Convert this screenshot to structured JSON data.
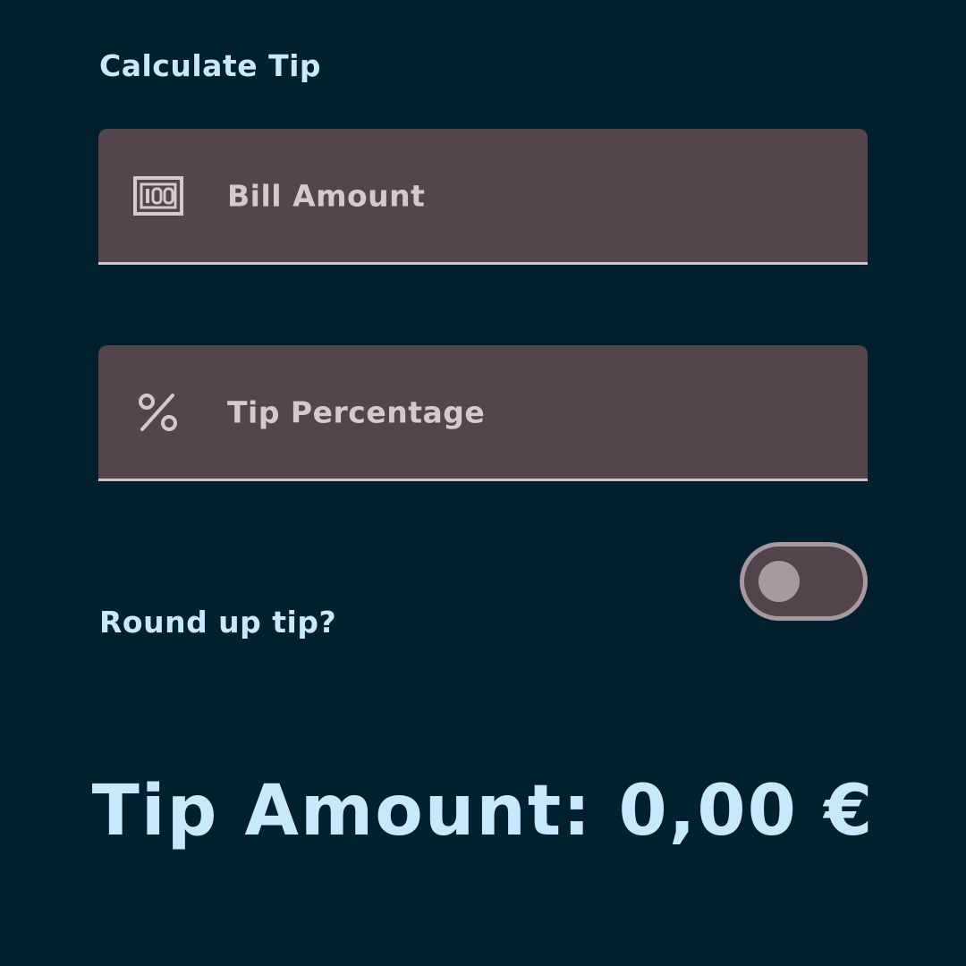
{
  "header": {
    "title": "Calculate Tip"
  },
  "bill_field": {
    "placeholder": "Bill Amount",
    "value": "",
    "icon": "money-icon"
  },
  "tip_field": {
    "placeholder": "Tip Percentage",
    "value": "",
    "icon": "percent-icon"
  },
  "round_up": {
    "label": "Round up tip?",
    "checked": false
  },
  "result": {
    "text": "Tip Amount: 0,00 €"
  },
  "colors": {
    "background": "#021f2e",
    "field_bg": "#52454b",
    "accent_text": "#c8e8fc",
    "field_text": "#d9c7cd"
  }
}
